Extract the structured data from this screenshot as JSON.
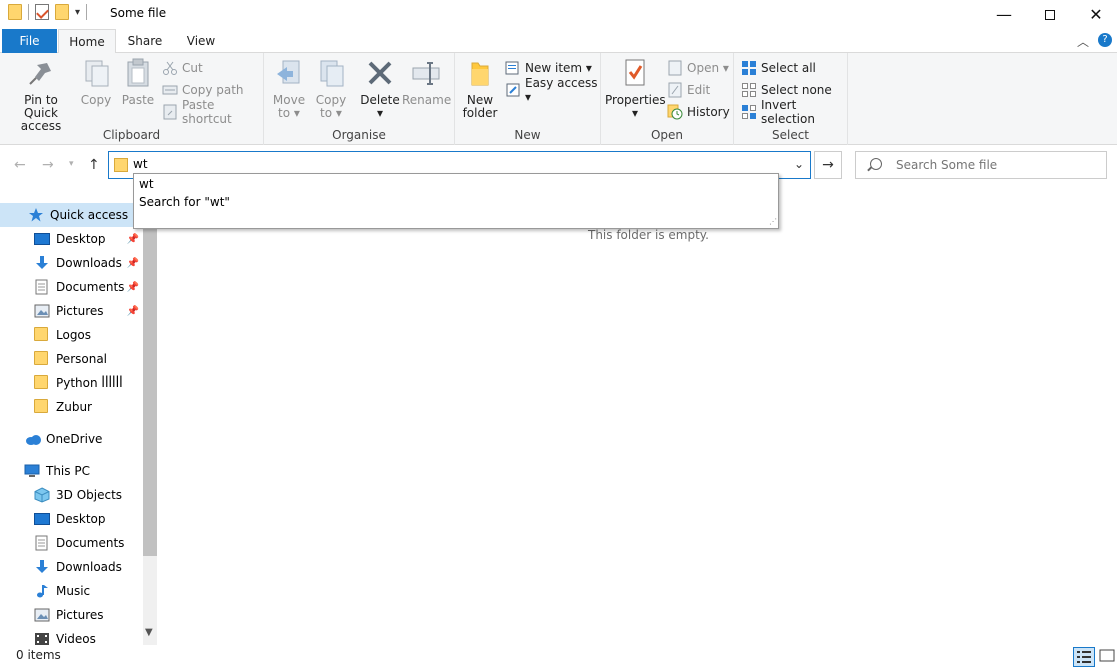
{
  "window": {
    "title": "Some file",
    "minimize_glyph": "—",
    "close_glyph": "✕"
  },
  "ribbon_tabs": {
    "file": "File",
    "home": "Home",
    "share": "Share",
    "view": "View"
  },
  "ribbon": {
    "clipboard": {
      "label": "Clipboard",
      "pin_to_quick_access_1": "Pin to Quick",
      "pin_to_quick_access_2": "access",
      "copy": "Copy",
      "paste": "Paste",
      "cut": "Cut",
      "copy_path": "Copy path",
      "paste_shortcut": "Paste shortcut"
    },
    "organise": {
      "label": "Organise",
      "move_to_1": "Move",
      "move_to_2": "to ▾",
      "copy_to_1": "Copy",
      "copy_to_2": "to ▾",
      "delete_1": "Delete",
      "delete_2": "▾",
      "rename": "Rename"
    },
    "new": {
      "label": "New",
      "new_folder_1": "New",
      "new_folder_2": "folder",
      "new_item": "New item ▾",
      "easy_access": "Easy access ▾"
    },
    "open": {
      "label": "Open",
      "properties_1": "Properties",
      "properties_2": "▾",
      "open": "Open ▾",
      "edit": "Edit",
      "history": "History"
    },
    "select": {
      "label": "Select",
      "select_all": "Select all",
      "select_none": "Select none",
      "invert_selection": "Invert selection"
    }
  },
  "address_bar": {
    "value": "wt",
    "go_glyph": "→"
  },
  "search": {
    "placeholder": "Search Some file"
  },
  "autocomplete": {
    "items": [
      "wt",
      "Search for \"wt\""
    ]
  },
  "nav_pane": {
    "quick_access": "Quick access",
    "quick_items": [
      {
        "label": "Desktop",
        "pinned": true
      },
      {
        "label": "Downloads",
        "pinned": true
      },
      {
        "label": "Documents",
        "pinned": true
      },
      {
        "label": "Pictures",
        "pinned": true
      },
      {
        "label": "Logos",
        "pinned": false
      },
      {
        "label": "Personal",
        "pinned": false
      },
      {
        "label": "Python ꟾꟾꟾꟾꟾꟾ",
        "pinned": false
      },
      {
        "label": "Zubur",
        "pinned": false
      }
    ],
    "onedrive": "OneDrive",
    "this_pc": "This PC",
    "pc_items": [
      "3D Objects",
      "Desktop",
      "Documents",
      "Downloads",
      "Music",
      "Pictures",
      "Videos"
    ]
  },
  "content": {
    "empty_message": "This folder is empty."
  },
  "status": {
    "item_count": "0 items"
  },
  "colors": {
    "accent": "#1979CA",
    "selected_bg": "#cce4f7",
    "folder": "#FFD66E"
  }
}
